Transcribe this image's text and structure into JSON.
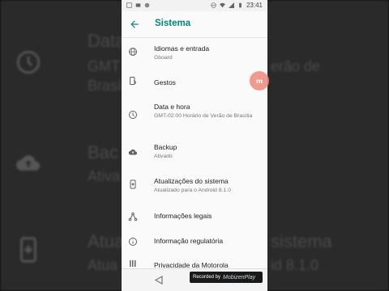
{
  "status_bar": {
    "time": "23:41"
  },
  "app_bar": {
    "title": "Sistema"
  },
  "items": [
    {
      "icon": "globe-icon",
      "title": "Idiomas e entrada",
      "subtitle": "Gboard"
    },
    {
      "icon": "gestures-icon",
      "title": "Gestos",
      "subtitle": ""
    },
    {
      "icon": "clock-icon",
      "title": "Data e hora",
      "subtitle": "GMT-02:00 Horário de Verão de Brasília"
    },
    {
      "icon": "cloud-upload-icon",
      "title": "Backup",
      "subtitle": "Ativado"
    },
    {
      "icon": "system-update-icon",
      "title": "Atualizações do sistema",
      "subtitle": "Atualizado para o Android 8.1.0"
    },
    {
      "icon": "share-tree-icon",
      "title": "Informações legais",
      "subtitle": ""
    },
    {
      "icon": "info-icon",
      "title": "Informação regulatória",
      "subtitle": ""
    },
    {
      "icon": "grid-icon",
      "title": "Privacidade da Motorola",
      "subtitle": ""
    }
  ],
  "background": {
    "rows": [
      {
        "title": "Data",
        "subtitle": "GMT",
        "subtitle_right": "erão de",
        "subtitle2": "Brasíl"
      },
      {
        "title": "Bac",
        "subtitle": "Ativa"
      },
      {
        "title": "Atua",
        "title_right": "sistema",
        "subtitle": "Atua",
        "subtitle_right": "id 8.1.0"
      }
    ]
  },
  "recorder_badge": {
    "prefix": "Recorded by",
    "brand": "MobizenPlay"
  },
  "floating_button": {
    "label": "m"
  },
  "colors": {
    "accent": "#00897b",
    "bubble": "#ef8a7a"
  }
}
